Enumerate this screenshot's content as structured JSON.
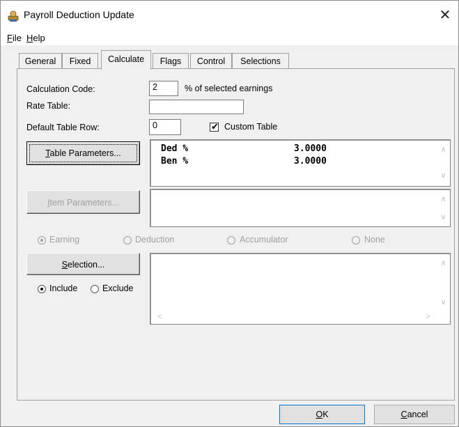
{
  "window": {
    "title": "Payroll Deduction Update",
    "close_glyph": "✕"
  },
  "menu": [
    {
      "label_prefix": "",
      "accel": "F",
      "label_rest": "ile"
    },
    {
      "label_prefix": "",
      "accel": "H",
      "label_rest": "elp"
    }
  ],
  "tabs": [
    "General",
    "Fixed",
    "Calculate",
    "Flags",
    "Control",
    "Selections"
  ],
  "active_tab": "Calculate",
  "form": {
    "calc_code_label": "Calculation Code:",
    "calc_code_value": "2",
    "calc_code_desc": "% of selected earnings",
    "rate_table_label": "Rate Table:",
    "rate_table_value": "",
    "default_row_label": "Default Table Row:",
    "default_row_value": "0",
    "custom_table_label": "Custom Table",
    "custom_table_checked": true
  },
  "table_parameters": {
    "button_accel": "T",
    "button_rest": "able Parameters...",
    "rows": [
      {
        "name": "Ded %",
        "value": "3.0000"
      },
      {
        "name": "Ben %",
        "value": "3.0000"
      }
    ]
  },
  "item_parameters": {
    "button_accel": "I",
    "button_rest": "tem Parameters..."
  },
  "item_type_options": [
    {
      "label": "Earning",
      "selected": true
    },
    {
      "label": "Deduction",
      "selected": false
    },
    {
      "label": "Accumulator",
      "selected": false
    },
    {
      "label": "None",
      "selected": false
    }
  ],
  "selection": {
    "button_accel": "S",
    "button_rest": "election...",
    "include_label": "Include",
    "exclude_label": "Exclude",
    "mode": "Include"
  },
  "buttons": {
    "ok_accel": "O",
    "ok_rest": "K",
    "cancel_accel": "C",
    "cancel_rest": "ancel"
  },
  "icons": {
    "app": "payroll-app-icon",
    "check": "checkmark-icon",
    "scroll_up": "scroll-up-arrow-icon",
    "scroll_down": "scroll-down-arrow-icon",
    "scroll_left": "scroll-left-arrow-icon",
    "scroll_right": "scroll-right-arrow-icon"
  }
}
